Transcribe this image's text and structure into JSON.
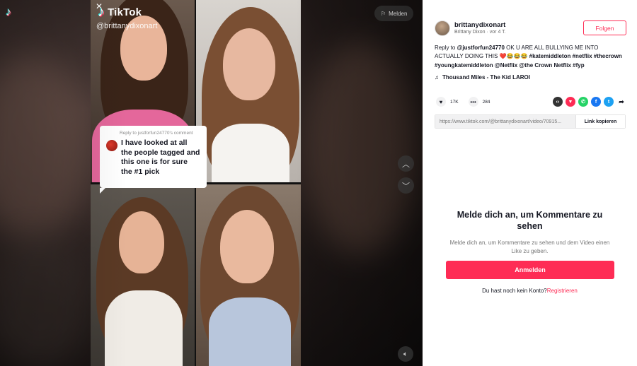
{
  "overlay": {
    "brand": "TikTok",
    "handle": "@brittanydixonart",
    "close_glyph": "✕",
    "report_label": "Melden",
    "reply_header": "Reply to justforfun24770's comment",
    "reply_text": "I have looked at all the people tagged and this one is for sure the #1 pick"
  },
  "icons": {
    "tiktok": "tiktok-icon",
    "flag": "flag-icon",
    "up": "chevron-up-icon",
    "down": "chevron-down-icon",
    "volume": "volume-icon",
    "heart": "heart-icon",
    "comment": "comment-icon",
    "music": "music-note-icon"
  },
  "panel": {
    "author_name": "brittanydixonart",
    "author_sub": "Brittany Dixon · vor 4 T.",
    "follow_label": "Folgen",
    "caption_reply_prefix": "Reply to ",
    "caption_reply_user": "@justforfun24770",
    "caption_text": " OK U ARE ALL BULLYING ME INTO ACTUALLY DOING THIS ❤️😂😂😂 ",
    "caption_tags": "#katemiddleton #netflix #thecrown #youngkatemiddleton @Netflix @the Crown Netflix #fyp",
    "music_title": "Thousand Miles - The Kid LAROI",
    "likes": "17K",
    "comments": "284",
    "share_icons": [
      {
        "name": "embed-icon",
        "glyph": "‹›",
        "color": "#333333"
      },
      {
        "name": "send-icon",
        "glyph": "▼",
        "color": "#fe2c55"
      },
      {
        "name": "whatsapp-icon",
        "glyph": "✆",
        "color": "#25d366"
      },
      {
        "name": "facebook-icon",
        "glyph": "f",
        "color": "#1877f2"
      },
      {
        "name": "twitter-icon",
        "glyph": "t",
        "color": "#1da1f2"
      },
      {
        "name": "share-arrow-icon",
        "glyph": "➦",
        "color": "#ffffff"
      }
    ],
    "link_url": "https://www.tiktok.com/@brittanydixonart/video/70915...",
    "link_copy_label": "Link kopieren",
    "login_title": "Melde dich an, um Kommentare zu sehen",
    "login_sub": "Melde dich an, um Kommentare zu sehen und dem Video einen Like zu geben.",
    "login_button": "Anmelden",
    "signup_prompt": "Du hast noch kein Konto?",
    "signup_link": "Registrieren"
  },
  "colors": {
    "accent": "#fe2c55",
    "text": "#161823"
  }
}
